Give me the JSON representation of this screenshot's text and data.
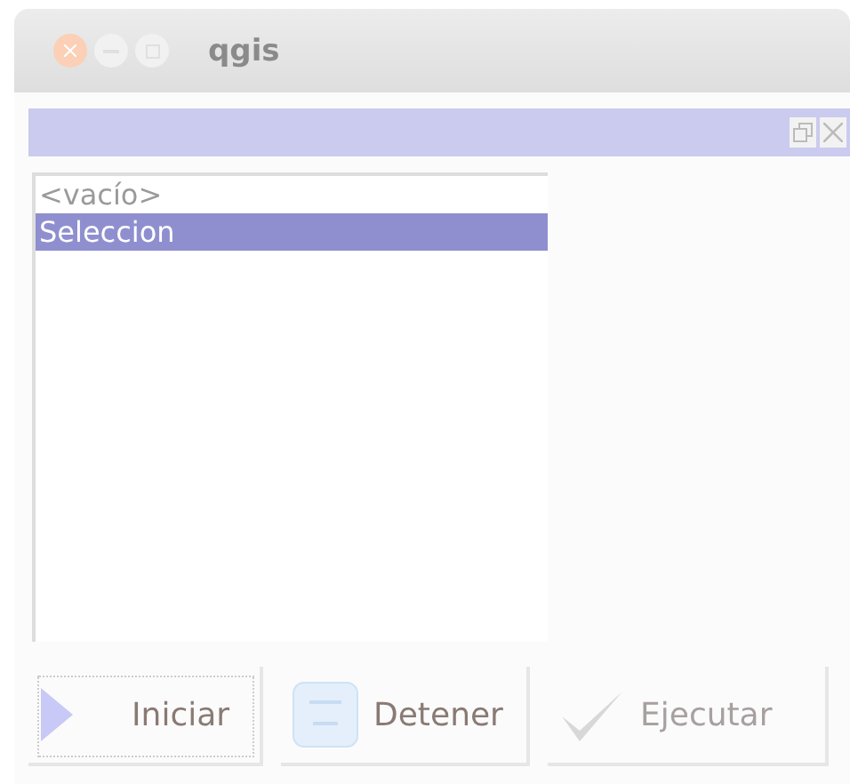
{
  "window": {
    "title": "qgis"
  },
  "list": {
    "items": [
      {
        "label": "<vacío>",
        "selected": false
      },
      {
        "label": "Seleccion",
        "selected": true
      }
    ]
  },
  "buttons": [
    {
      "label": "Iniciar",
      "kind": "play",
      "disabled": false,
      "focused": true
    },
    {
      "label": "Detener",
      "kind": "stop",
      "disabled": false,
      "focused": false
    },
    {
      "label": "Ejecutar",
      "kind": "run",
      "disabled": true,
      "focused": false
    }
  ]
}
